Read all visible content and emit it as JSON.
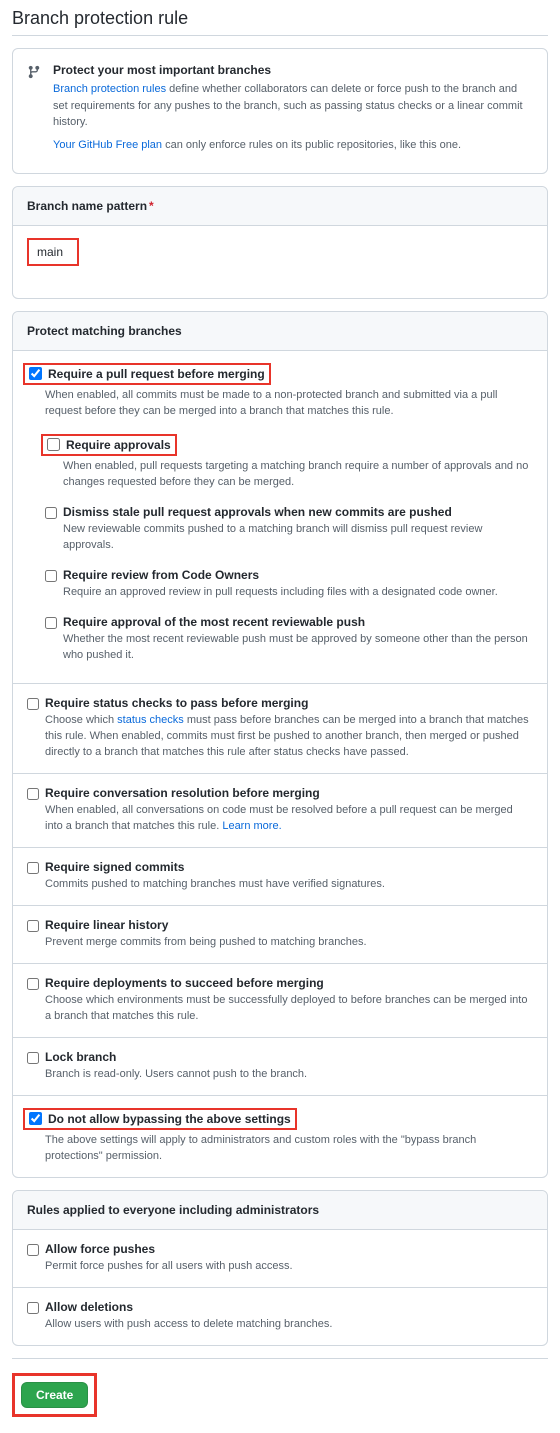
{
  "page_title": "Branch protection rule",
  "protect_box": {
    "title": "Protect your most important branches",
    "link1": "Branch protection rules",
    "desc1": " define whether collaborators can delete or force push to the branch and set requirements for any pushes to the branch, such as passing status checks or a linear commit history.",
    "link2": "Your GitHub Free plan",
    "desc2": " can only enforce rules on its public repositories, like this one."
  },
  "branch_pattern": {
    "header": "Branch name pattern",
    "value": "main"
  },
  "protect_header": "Protect matching branches",
  "rules": {
    "require_pr": {
      "label": "Require a pull request before merging",
      "desc": "When enabled, all commits must be made to a non-protected branch and submitted via a pull request before they can be merged into a branch that matches this rule.",
      "checked": true
    },
    "require_approvals": {
      "label": "Require approvals",
      "desc": "When enabled, pull requests targeting a matching branch require a number of approvals and no changes requested before they can be merged.",
      "checked": false
    },
    "dismiss_stale": {
      "label": "Dismiss stale pull request approvals when new commits are pushed",
      "desc": "New reviewable commits pushed to a matching branch will dismiss pull request review approvals.",
      "checked": false
    },
    "code_owners": {
      "label": "Require review from Code Owners",
      "desc": "Require an approved review in pull requests including files with a designated code owner.",
      "checked": false
    },
    "last_push": {
      "label": "Require approval of the most recent reviewable push",
      "desc": "Whether the most recent reviewable push must be approved by someone other than the person who pushed it.",
      "checked": false
    },
    "status_checks": {
      "label": "Require status checks to pass before merging",
      "desc_pre": "Choose which ",
      "link": "status checks",
      "desc_post": " must pass before branches can be merged into a branch that matches this rule. When enabled, commits must first be pushed to another branch, then merged or pushed directly to a branch that matches this rule after status checks have passed.",
      "checked": false
    },
    "conversation": {
      "label": "Require conversation resolution before merging",
      "desc": "When enabled, all conversations on code must be resolved before a pull request can be merged into a branch that matches this rule. ",
      "learn_more": "Learn more.",
      "checked": false
    },
    "signed": {
      "label": "Require signed commits",
      "desc": "Commits pushed to matching branches must have verified signatures.",
      "checked": false
    },
    "linear": {
      "label": "Require linear history",
      "desc": "Prevent merge commits from being pushed to matching branches.",
      "checked": false
    },
    "deployments": {
      "label": "Require deployments to succeed before merging",
      "desc": "Choose which environments must be successfully deployed to before branches can be merged into a branch that matches this rule.",
      "checked": false
    },
    "lock": {
      "label": "Lock branch",
      "desc": "Branch is read-only. Users cannot push to the branch.",
      "checked": false
    },
    "no_bypass": {
      "label": "Do not allow bypassing the above settings",
      "desc": "The above settings will apply to administrators and custom roles with the \"bypass branch protections\" permission.",
      "checked": true
    }
  },
  "everyone_header": "Rules applied to everyone including administrators",
  "everyone": {
    "force_push": {
      "label": "Allow force pushes",
      "desc": "Permit force pushes for all users with push access.",
      "checked": false
    },
    "deletions": {
      "label": "Allow deletions",
      "desc": "Allow users with push access to delete matching branches.",
      "checked": false
    }
  },
  "create_button": "Create"
}
